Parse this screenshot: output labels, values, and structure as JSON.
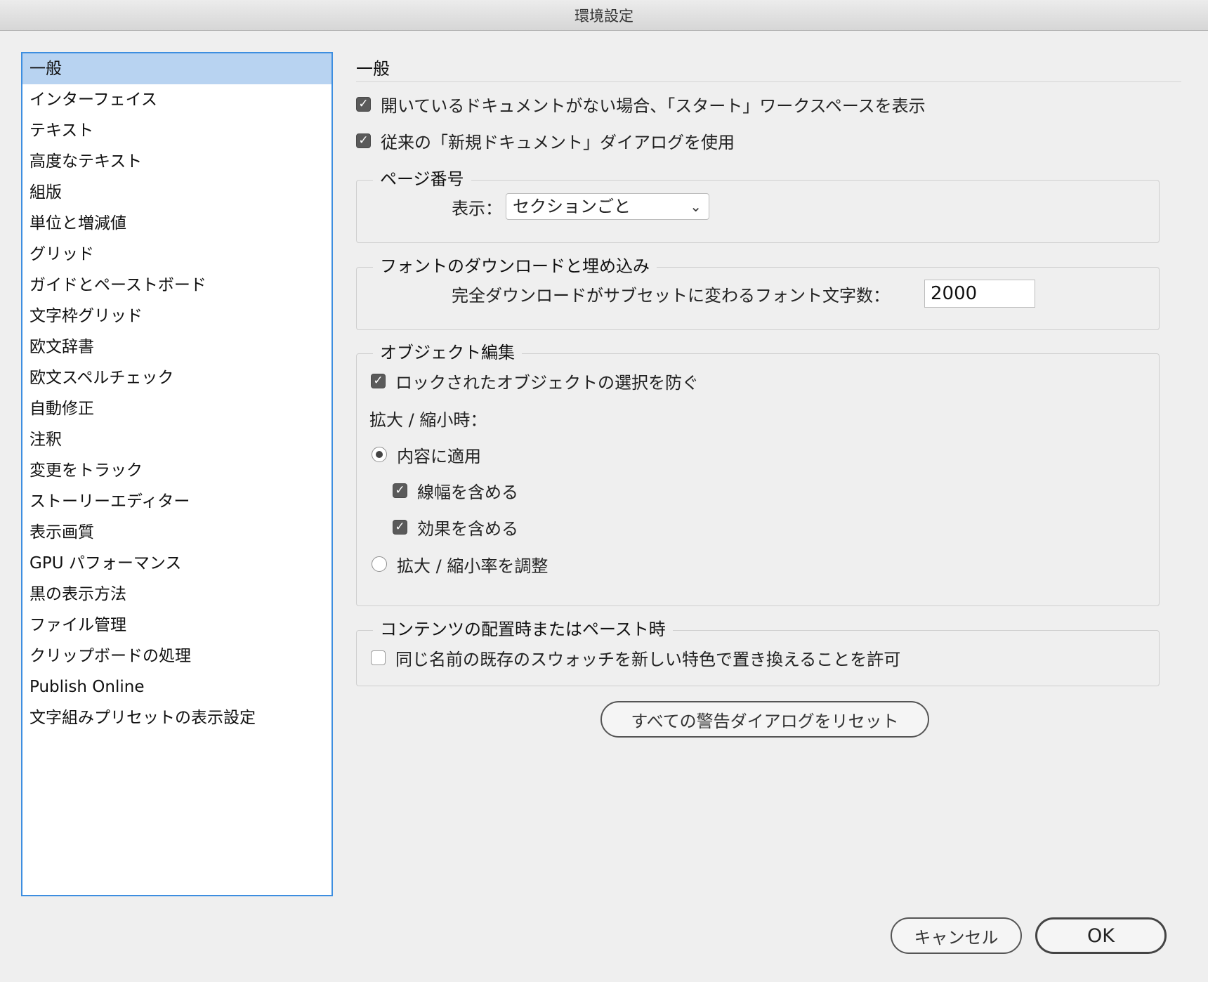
{
  "window": {
    "title": "環境設定"
  },
  "sidebar": {
    "items": [
      {
        "label": "一般",
        "selected": true
      },
      {
        "label": "インターフェイス"
      },
      {
        "label": "テキスト"
      },
      {
        "label": "高度なテキスト"
      },
      {
        "label": "組版"
      },
      {
        "label": "単位と増減値"
      },
      {
        "label": "グリッド"
      },
      {
        "label": "ガイドとペーストボード"
      },
      {
        "label": "文字枠グリッド"
      },
      {
        "label": "欧文辞書"
      },
      {
        "label": "欧文スペルチェック"
      },
      {
        "label": "自動修正"
      },
      {
        "label": "注釈"
      },
      {
        "label": "変更をトラック"
      },
      {
        "label": "ストーリーエディター"
      },
      {
        "label": "表示画質"
      },
      {
        "label": "GPU パフォーマンス"
      },
      {
        "label": "黒の表示方法"
      },
      {
        "label": "ファイル管理"
      },
      {
        "label": "クリップボードの処理"
      },
      {
        "label": "Publish Online"
      },
      {
        "label": "文字組みプリセットの表示設定"
      }
    ]
  },
  "main": {
    "title": "一般",
    "show_start_workspace": {
      "label": "開いているドキュメントがない場合、「スタート」ワークスペースを表示",
      "checked": true
    },
    "legacy_new_doc": {
      "label": "従来の「新規ドキュメント」ダイアログを使用",
      "checked": true
    },
    "page_numbering": {
      "legend": "ページ番号",
      "view_label": "表示：",
      "view_value": "セクションごと"
    },
    "font_download": {
      "legend": "フォントのダウンロードと埋め込み",
      "threshold_label": "完全ダウンロードがサブセットに変わるフォント文字数：",
      "threshold_value": "2000"
    },
    "object_editing": {
      "legend": "オブジェクト編集",
      "prevent_locked": {
        "label": "ロックされたオブジェクトの選択を防ぐ",
        "checked": true
      },
      "scaling_label": "拡大 / 縮小時：",
      "apply_to_content": {
        "label": "内容に適用",
        "selected": true
      },
      "include_stroke": {
        "label": "線幅を含める",
        "checked": true
      },
      "include_effects": {
        "label": "効果を含める",
        "checked": true
      },
      "adjust_scaling": {
        "label": "拡大 / 縮小率を調整",
        "selected": false
      }
    },
    "paste": {
      "legend": "コンテンツの配置時またはペースト時",
      "allow_replace": {
        "label": "同じ名前の既存のスウォッチを新しい特色で置き換えることを許可",
        "checked": false
      }
    },
    "reset_warnings_label": "すべての警告ダイアログをリセット"
  },
  "footer": {
    "cancel_label": "キャンセル",
    "ok_label": "OK"
  },
  "colors": {
    "selection": "#b8d3f1",
    "focus_ring": "#3d8ee0",
    "background": "#efefef"
  }
}
